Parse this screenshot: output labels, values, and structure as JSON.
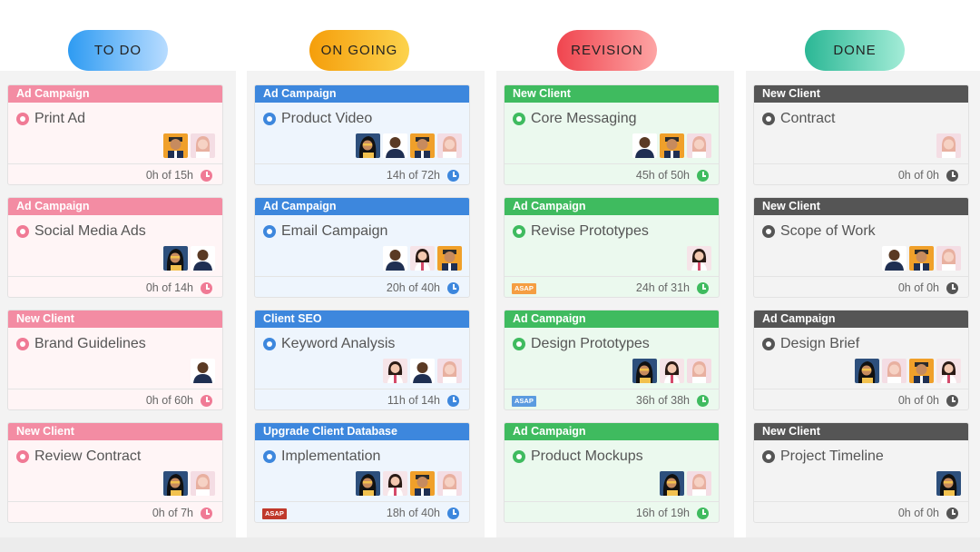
{
  "colors": {
    "todo": {
      "pill_from": "#2e9bf2",
      "pill_to": "#b8dcff",
      "tag": "#f38ca3",
      "card_bg": "#fff5f6",
      "accent": "#f07a95"
    },
    "ongoing": {
      "pill_from": "#f59e0b",
      "pill_to": "#fcd34d",
      "tag": "#3d87dd",
      "card_bg": "#eef5fd",
      "accent": "#3d87dd"
    },
    "revision": {
      "pill_from": "#f0454f",
      "pill_to": "#fda4a4",
      "tag": "#3fbb5f",
      "card_bg": "#ebf9ee",
      "accent": "#3fbb5f"
    },
    "done": {
      "pill_from": "#2bb795",
      "pill_to": "#a3ecd7",
      "tag": "#555555",
      "card_bg": "#f3f3f3",
      "accent": "#555555"
    },
    "asap_orange": "#f59e42",
    "asap_blue": "#5b9be0",
    "asap_red": "#c0392b"
  },
  "columns": [
    {
      "label": "TO DO",
      "cards": [
        {
          "tag": "Ad Campaign",
          "title": "Print Ad",
          "avatars": [
            "man-orange-bg",
            "woman-pink-bg"
          ],
          "time": "0h of 15h",
          "asap": ""
        },
        {
          "tag": "Ad Campaign",
          "title": "Social Media Ads",
          "avatars": [
            "woman-dark-hair",
            "man-dark"
          ],
          "time": "0h of 14h",
          "asap": ""
        },
        {
          "tag": "New Client",
          "title": "Brand Guidelines",
          "avatars": [
            "man-dark"
          ],
          "time": "0h of 60h",
          "asap": ""
        },
        {
          "tag": "New Client",
          "title": "Review Contract",
          "avatars": [
            "woman-dark-hair",
            "woman-pink-bg"
          ],
          "time": "0h of 7h",
          "asap": ""
        }
      ]
    },
    {
      "label": "ON GOING",
      "cards": [
        {
          "tag": "Ad Campaign",
          "title": "Product Video",
          "avatars": [
            "woman-dark-hair",
            "man-dark",
            "man-orange-bg",
            "woman-pink-bg"
          ],
          "time": "14h of 72h",
          "asap": ""
        },
        {
          "tag": "Ad Campaign",
          "title": "Email Campaign",
          "avatars": [
            "man-dark",
            "woman-light",
            "man-orange-bg"
          ],
          "time": "20h of 40h",
          "asap": ""
        },
        {
          "tag": "Client SEO",
          "title": "Keyword Analysis",
          "avatars": [
            "woman-light",
            "man-dark",
            "woman-pink-bg"
          ],
          "time": "11h of 14h",
          "asap": ""
        },
        {
          "tag": "Upgrade Client Database",
          "title": "Implementation",
          "avatars": [
            "woman-dark-hair",
            "woman-light",
            "man-orange-bg",
            "woman-pink-bg"
          ],
          "time": "18h of 40h",
          "asap": "ASAP"
        }
      ]
    },
    {
      "label": "REVISION",
      "cards": [
        {
          "tag": "New Client",
          "title": "Core Messaging",
          "avatars": [
            "man-dark",
            "man-orange-bg",
            "woman-pink-bg"
          ],
          "time": "45h of 50h",
          "asap": ""
        },
        {
          "tag": "Ad Campaign",
          "title": "Revise Prototypes",
          "avatars": [
            "woman-light"
          ],
          "time": "24h of 31h",
          "asap": "ASAP"
        },
        {
          "tag": "Ad Campaign",
          "title": "Design Prototypes",
          "avatars": [
            "woman-dark-hair",
            "woman-light",
            "woman-pink-bg"
          ],
          "time": "36h of 38h",
          "asap": "ASAP"
        },
        {
          "tag": "Ad Campaign",
          "title": "Product Mockups",
          "avatars": [
            "woman-dark-hair",
            "woman-pink-bg"
          ],
          "time": "16h of 19h",
          "asap": ""
        }
      ]
    },
    {
      "label": "DONE",
      "cards": [
        {
          "tag": "New Client",
          "title": "Contract",
          "avatars": [
            "woman-pink-bg"
          ],
          "time": "0h of 0h",
          "asap": ""
        },
        {
          "tag": "New Client",
          "title": "Scope of Work",
          "avatars": [
            "man-dark",
            "man-orange-bg",
            "woman-pink-bg"
          ],
          "time": "0h of 0h",
          "asap": ""
        },
        {
          "tag": "Ad Campaign",
          "title": "Design Brief",
          "avatars": [
            "woman-dark-hair",
            "woman-pink-bg",
            "man-orange-bg",
            "woman-light"
          ],
          "time": "0h of 0h",
          "asap": ""
        },
        {
          "tag": "New Client",
          "title": "Project Timeline",
          "avatars": [
            "woman-dark-hair"
          ],
          "time": "0h of 0h",
          "asap": ""
        }
      ]
    }
  ]
}
